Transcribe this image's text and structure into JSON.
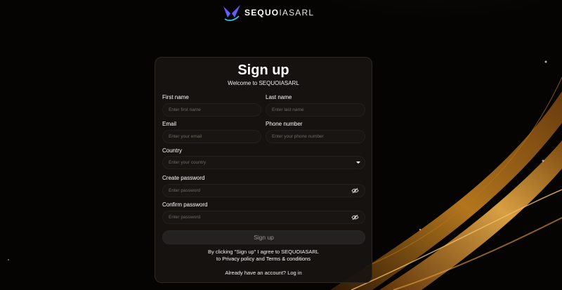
{
  "brand": {
    "name_bold": "SEQUO",
    "name_thin": "IASARL",
    "logo_icon": "bird-logo-icon"
  },
  "form": {
    "title": "Sign up",
    "subtitle": "Welcome to SEQUOIASARL",
    "first_name": {
      "label": "First name",
      "placeholder": "Enter first name"
    },
    "last_name": {
      "label": "Last name",
      "placeholder": "Enter last name"
    },
    "email": {
      "label": "Email",
      "placeholder": "Enter your email"
    },
    "phone": {
      "label": "Phone number",
      "placeholder": "Enter your phone number"
    },
    "country": {
      "label": "Country",
      "placeholder": "Enter your country",
      "icon": "caret-down-icon"
    },
    "create_password": {
      "label": "Create password",
      "placeholder": "Enter password",
      "icon": "eye-off-icon"
    },
    "confirm_password": {
      "label": "Confirm password",
      "placeholder": "Enter password",
      "icon": "eye-off-icon"
    },
    "submit_label": "Sign up",
    "terms_prefix": "By clicking \"Sign up\" I agree to SEQUOIASARL",
    "terms_to": "to",
    "privacy_link": "Privacy policy",
    "terms_and": "and",
    "terms_link": "Terms & conditions",
    "login_prompt": "Already have an account?",
    "login_link": "Log in"
  },
  "colors": {
    "background": "#050403",
    "card": "#181410",
    "accent_gold": "#c8821e"
  }
}
